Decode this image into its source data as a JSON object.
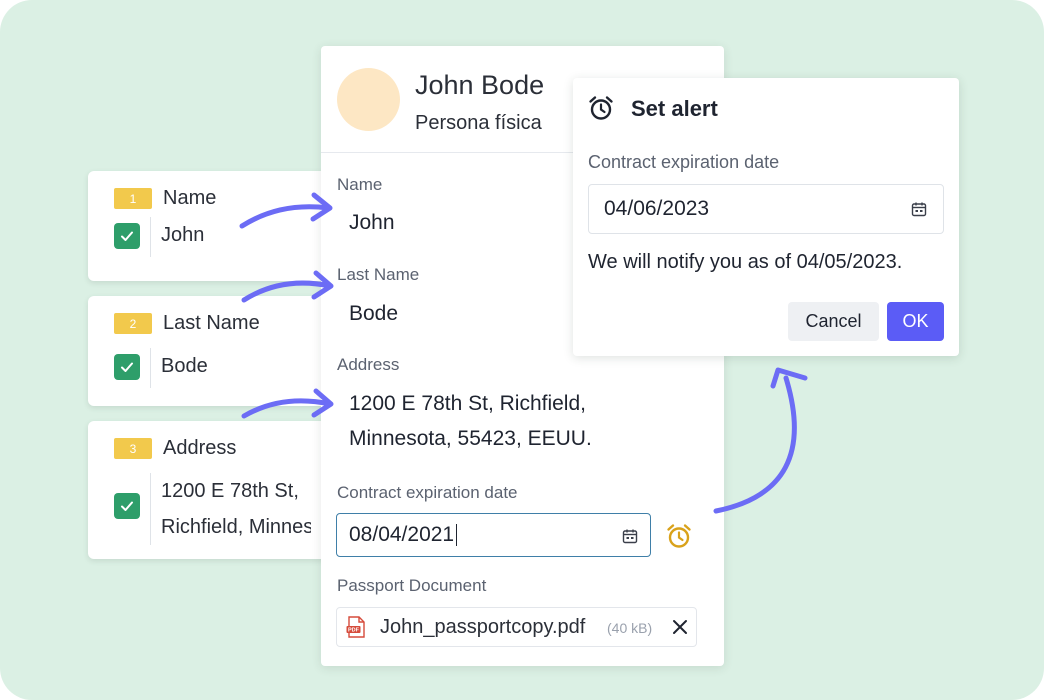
{
  "extracted": [
    {
      "number": "1",
      "field": "Name",
      "value_lines": [
        "John"
      ]
    },
    {
      "number": "2",
      "field": "Last Name",
      "value_lines": [
        "Bode"
      ]
    },
    {
      "number": "3",
      "field": "Address",
      "value_lines": [
        "1200 E 78th St,",
        "Richfield, Minnes"
      ]
    }
  ],
  "profile": {
    "name": "John Bode",
    "type": "Persona física"
  },
  "form": {
    "name": {
      "label": "Name",
      "value": "John"
    },
    "last_name": {
      "label": "Last Name",
      "value": "Bode"
    },
    "address": {
      "label": "Address",
      "line1": "1200 E 78th St, Richfield,",
      "line2": "Minnesota, 55423, EEUU."
    },
    "contract": {
      "label": "Contract expiration date",
      "value": "08/04/2021"
    },
    "passport": {
      "label": "Passport Document",
      "file_name": "John_passportcopy.pdf",
      "file_size": "(40 kB)"
    }
  },
  "alert": {
    "title": "Set alert",
    "field_label": "Contract expiration date",
    "date_value": "04/06/2023",
    "note": "We will notify you as of 04/05/2023.",
    "cancel_label": "Cancel",
    "ok_label": "OK"
  },
  "icons": {
    "check": "check-icon",
    "calendar": "calendar-icon",
    "alarm": "alarm-clock-icon",
    "pdf": "pdf-file-icon",
    "close": "close-icon"
  },
  "colors": {
    "background": "#dbf0e4",
    "badge": "#f2c94c",
    "check": "#2e9e6a",
    "arrow": "#6c6cf5",
    "primary_button": "#5b5cf6",
    "alarm": "#d9a21b",
    "avatar": "#fde7c4"
  }
}
